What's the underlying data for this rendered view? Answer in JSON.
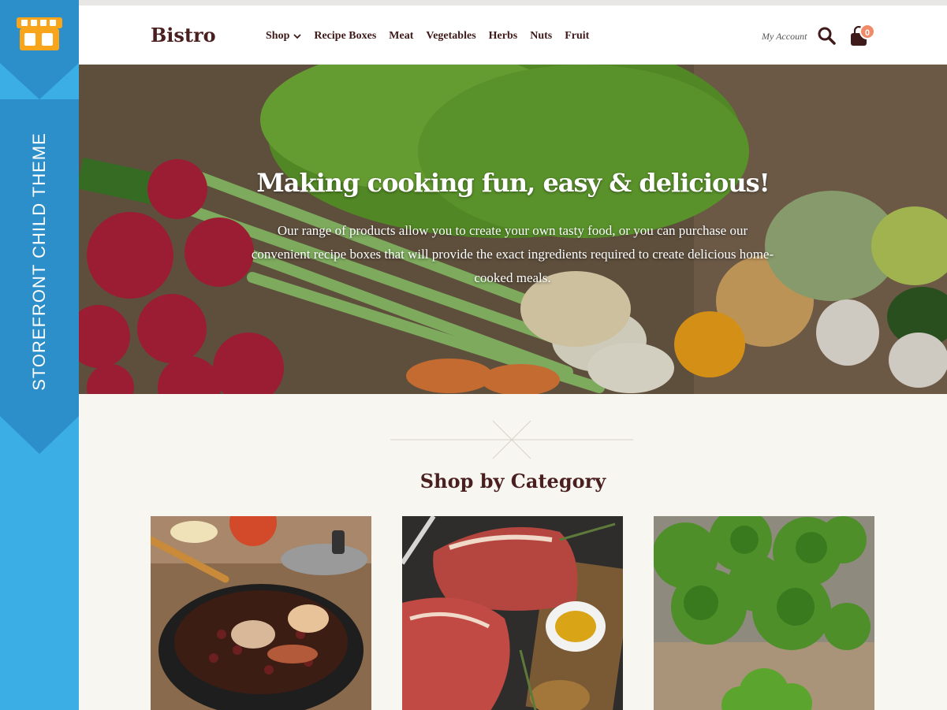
{
  "ribbon": {
    "label": "STOREFRONT CHILD THEME",
    "icon": "storefront-icon",
    "color": "#3baee6"
  },
  "header": {
    "brand": "Bistro",
    "nav": [
      "Shop",
      "Recipe Boxes",
      "Meat",
      "Vegetables",
      "Herbs",
      "Nuts",
      "Fruit"
    ],
    "account": "My Account",
    "cart_count": "0",
    "accent": "#f08a68"
  },
  "hero": {
    "title": "Making cooking fun, easy & delicious!",
    "text": "Our range of products allow you to create your own tasty food, or you can purchase our convenient recipe boxes that will provide the exact ingredients required to create delicious home-cooked meals."
  },
  "categories": {
    "title": "Shop by Category",
    "items": [
      {
        "icon": "stew-pot-image"
      },
      {
        "icon": "raw-steak-image"
      },
      {
        "icon": "broccoli-image"
      }
    ]
  }
}
